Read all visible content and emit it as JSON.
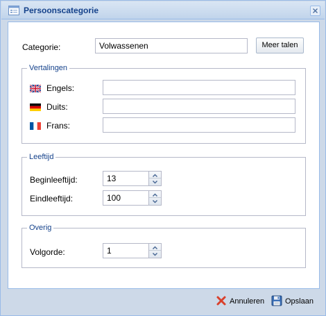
{
  "window": {
    "title": "Persoonscategorie",
    "title_icon": "form-icon",
    "close_icon": "close-icon"
  },
  "categorie": {
    "label": "Categorie:",
    "value": "Volwassenen",
    "meer_talen_label": "Meer talen"
  },
  "vertalingen": {
    "legend": "Vertalingen",
    "rows": [
      {
        "flag": "uk-flag-icon",
        "label": "Engels:",
        "value": ""
      },
      {
        "flag": "german-flag-icon",
        "label": "Duits:",
        "value": ""
      },
      {
        "flag": "french-flag-icon",
        "label": "Frans:",
        "value": ""
      }
    ]
  },
  "leeftijd": {
    "legend": "Leeftijd",
    "begin": {
      "label": "Beginleeftijd:",
      "value": "13"
    },
    "eind": {
      "label": "Eindleeftijd:",
      "value": "100"
    }
  },
  "overig": {
    "legend": "Overig",
    "volgorde": {
      "label": "Volgorde:",
      "value": "1"
    }
  },
  "footer": {
    "cancel_label": "Annuleren",
    "cancel_icon": "cross-icon",
    "cancel_color": "#d9402c",
    "save_label": "Opslaan",
    "save_icon": "floppy-disk-icon"
  },
  "colors": {
    "accent": "#15428b",
    "border": "#99bbe8"
  }
}
